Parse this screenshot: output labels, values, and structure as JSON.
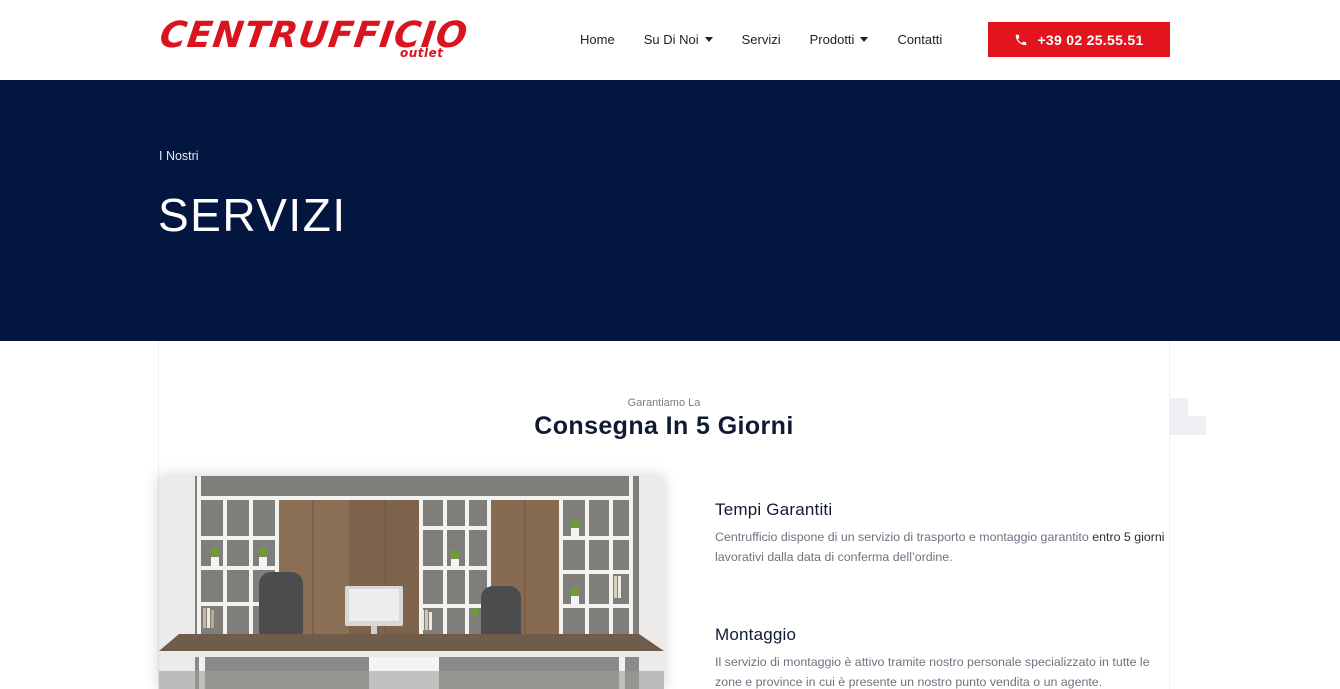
{
  "header": {
    "logo_text": "CENTRUFFICIO",
    "logo_sub": "outlet",
    "nav": [
      {
        "label": "Home",
        "dropdown": false
      },
      {
        "label": "Su Di Noi",
        "dropdown": true
      },
      {
        "label": "Servizi",
        "dropdown": false
      },
      {
        "label": "Prodotti",
        "dropdown": true
      },
      {
        "label": "Contatti",
        "dropdown": false
      }
    ],
    "phone": "+39 02 25.55.51",
    "phone_icon": "phone-icon"
  },
  "hero": {
    "kicker": "I Nostri",
    "title": "SERVIZI",
    "background": "#021640"
  },
  "section": {
    "kicker": "Garantiamo La",
    "title": "Consegna In 5 Giorni"
  },
  "features": [
    {
      "title": "Tempi Garantiti",
      "text_before": "Centrufficio dispone di un servizio di trasporto e montaggio garantito ",
      "text_strong": "entro 5 giorni",
      "text_after": " lavorativi dalla data di conferma dell’ordine."
    },
    {
      "title": "Montaggio",
      "text_before": "Il servizio di montaggio è attivo tramite nostro personale specializzato in tutte le zone e province in cui è presente un nostro punto vendita o un agente.",
      "text_strong": "",
      "text_after": ""
    }
  ],
  "colors": {
    "brand_red": "#e3141d",
    "navy": "#021640"
  }
}
